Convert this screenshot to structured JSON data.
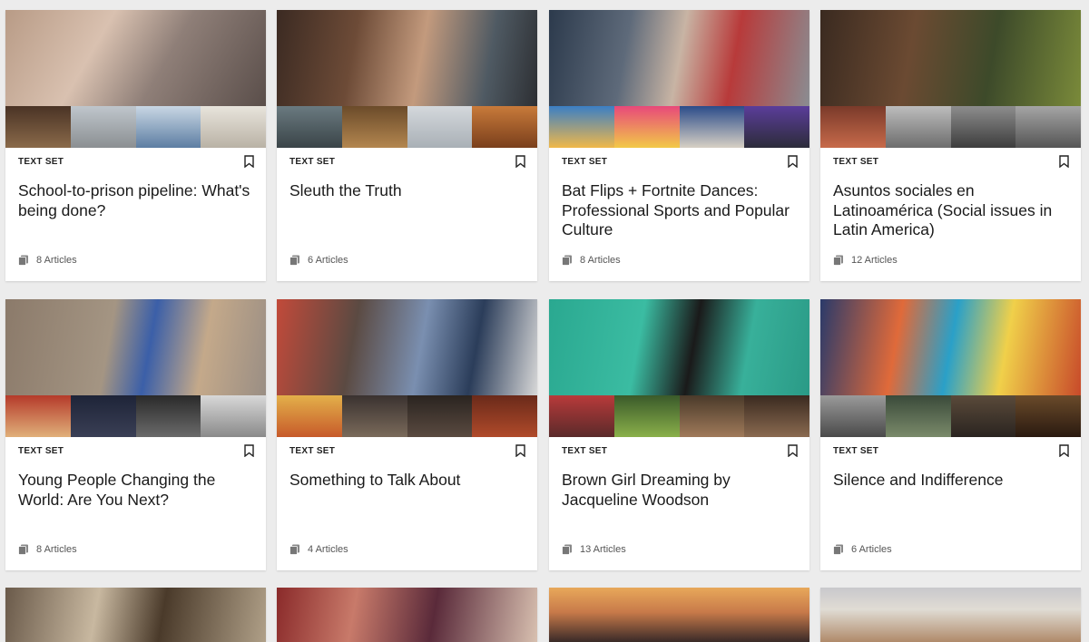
{
  "cards": [
    {
      "type": "TEXT SET",
      "title": "School-to-prison pipeline: What's being done?",
      "count": "8 Articles"
    },
    {
      "type": "TEXT SET",
      "title": "Sleuth the Truth",
      "count": "6 Articles"
    },
    {
      "type": "TEXT SET",
      "title": "Bat Flips + Fortnite Dances: Professional Sports and Popular Culture",
      "count": "8 Articles"
    },
    {
      "type": "TEXT SET",
      "title": "Asuntos sociales en Latinoamérica (Social issues in Latin America)",
      "count": "12 Articles"
    },
    {
      "type": "TEXT SET",
      "title": "Young People Changing the World: Are You Next?",
      "count": "8 Articles"
    },
    {
      "type": "TEXT SET",
      "title": "Something to Talk About",
      "count": "4 Articles"
    },
    {
      "type": "TEXT SET",
      "title": "Brown Girl Dreaming by Jacqueline Woodson",
      "count": "13 Articles"
    },
    {
      "type": "TEXT SET",
      "title": "Silence and Indifference",
      "count": "6 Articles"
    }
  ],
  "icons": {
    "bookmark": "bookmark-icon",
    "articles": "articles-stack-icon"
  },
  "colors": {
    "background": "#ececec",
    "card": "#ffffff",
    "text": "#1a1a1a",
    "meta": "#555555"
  }
}
